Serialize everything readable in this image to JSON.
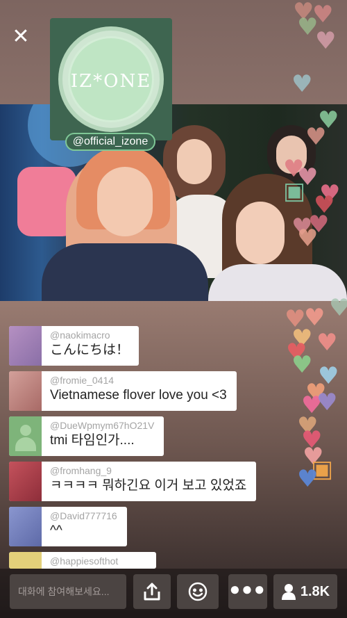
{
  "header": {
    "close_icon": "close-icon",
    "broadcaster_handle": "@official_izone",
    "logo_text": "IZ*ONE"
  },
  "comments": [
    {
      "username": "@naokimacro",
      "message": "こんにちは！",
      "avatar_color": "#a07bb0"
    },
    {
      "username": "@fromie_0414",
      "message": "Vietnamese flover love you <3",
      "avatar_color": "#c98a84"
    },
    {
      "username": "@DueWpmym67hO21V",
      "message": "tmi 타임인가....",
      "avatar_color": "#7eb47a"
    },
    {
      "username": "@fromhang_9",
      "message": "ㅋㅋㅋㅋ 뭐하긴요 이거 보고 있었죠",
      "avatar_color": "#b8434f"
    },
    {
      "username": "@David777716",
      "message": "^^",
      "avatar_color": "#6f7fbd"
    },
    {
      "username": "@happiesofthot",
      "message": "",
      "avatar_color": "#e3d07a"
    }
  ],
  "bottom_bar": {
    "input_placeholder": "대화에 참여해보세요...",
    "share_icon": "share-icon",
    "sticker_icon": "emoji-sticker-icon",
    "more_icon": "more-icon",
    "viewer_icon": "person-icon",
    "viewer_count": "1.8K"
  },
  "colors": {
    "brand_green": "#3e6550",
    "handle_border": "#7fc796",
    "bar_button": "#4b4442"
  }
}
